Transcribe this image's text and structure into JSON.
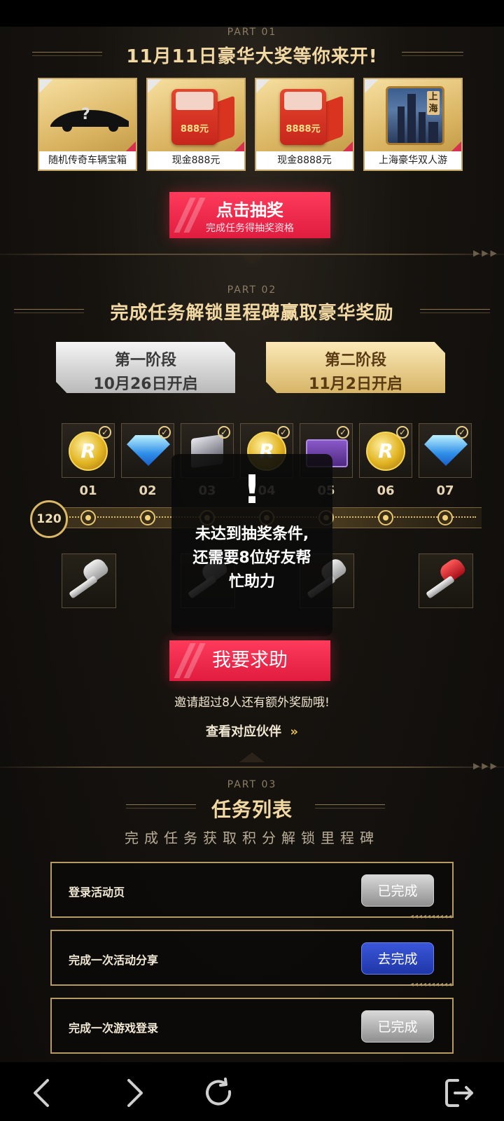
{
  "part1": {
    "label": "PART 01",
    "title": "11月11日豪华大奖等你来开!",
    "prizes": [
      {
        "caption": "随机传奇车辆宝箱",
        "icon": "mystery-car-icon"
      },
      {
        "caption": "现金888元",
        "icon": "red-envelope-icon",
        "amount": "888元"
      },
      {
        "caption": "现金8888元",
        "icon": "red-envelope-icon",
        "amount": "8888元"
      },
      {
        "caption": "上海豪华双人游",
        "icon": "shanghai-city-icon",
        "city": "上海"
      }
    ],
    "draw_button": {
      "label": "点击抽奖",
      "sublabel": "完成任务得抽奖资格"
    }
  },
  "part2": {
    "label": "PART 02",
    "title": "完成任务解锁里程碑赢取豪华奖励",
    "stages": [
      {
        "name": "第一阶段",
        "date": "10月26日开启"
      },
      {
        "name": "第二阶段",
        "date": "11月2日开启"
      }
    ],
    "milestones": [
      "01",
      "02",
      "03",
      "04",
      "05",
      "06",
      "07"
    ],
    "score": "120",
    "toast": {
      "icon": "!",
      "message": "未达到抽奖条件,还需要8位好友帮忙助力"
    },
    "help_button": "我要求助",
    "invite_note": "邀请超过8人还有额外奖励哦!",
    "view_partners": "查看对应伙伴"
  },
  "part3": {
    "label": "PART 03",
    "title": "任务列表",
    "subtitle": "完成任务获取积分解锁里程碑",
    "tasks": [
      {
        "name": "登录活动页",
        "status": "已完成"
      },
      {
        "name": "完成一次活动分享",
        "status": "去完成"
      },
      {
        "name": "完成一次游戏登录",
        "status": "已完成"
      }
    ]
  },
  "colors": {
    "accent_gold": "#f2d9a3",
    "red_button": "#e01c3f",
    "go_button": "#1f36a8"
  }
}
